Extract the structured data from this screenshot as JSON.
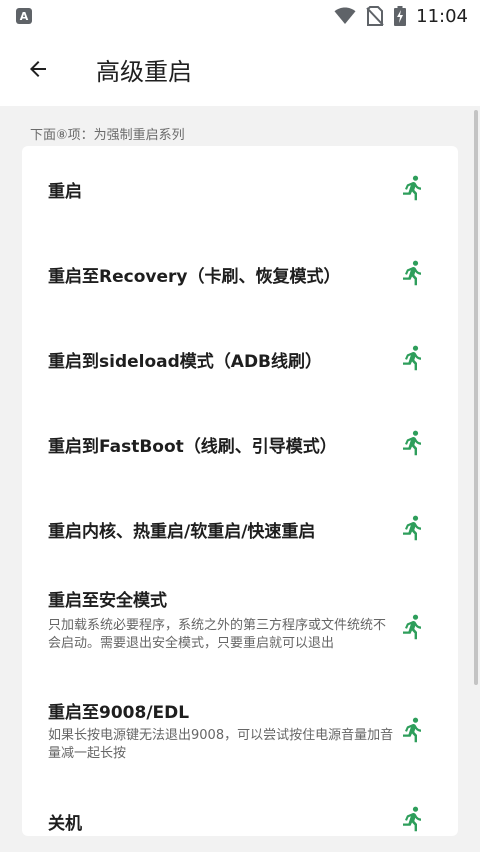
{
  "status_bar": {
    "notification_letter": "A",
    "time": "11:04",
    "icons": [
      "wifi-icon",
      "no-sim-icon",
      "battery-charging-icon"
    ]
  },
  "toolbar": {
    "back_icon": "arrow-left-icon",
    "title": "高级重启"
  },
  "section": {
    "header": "下面⑧项：为强制重启系列"
  },
  "items": [
    {
      "title": "重启",
      "description": "",
      "icon": "running-person-icon"
    },
    {
      "title": "重启至Recovery（卡刷、恢复模式）",
      "description": "",
      "icon": "running-person-icon"
    },
    {
      "title": "重启到sideload模式（ADB线刷）",
      "description": "",
      "icon": "running-person-icon"
    },
    {
      "title": "重启到FastBoot（线刷、引导模式）",
      "description": "",
      "icon": "running-person-icon"
    },
    {
      "title": "重启内核、热重启/软重启/快速重启",
      "description": "",
      "icon": "running-person-icon"
    },
    {
      "title": "重启至安全模式",
      "description": "只加载系统必要程序，系统之外的第三方程序或文件统统不会启动。需要退出安全模式，只要重启就可以退出",
      "icon": "running-person-icon"
    },
    {
      "title": "重启至9008/EDL",
      "description": "如果长按电源键无法退出9008，可以尝试按住电源音量加音量减一起长按",
      "icon": "running-person-icon"
    },
    {
      "title": "关机",
      "description": "",
      "icon": "running-person-icon"
    }
  ],
  "colors": {
    "accent_green": "#2e9e5b",
    "card_bg": "#ffffff",
    "page_bg": "#f2f2f2"
  }
}
